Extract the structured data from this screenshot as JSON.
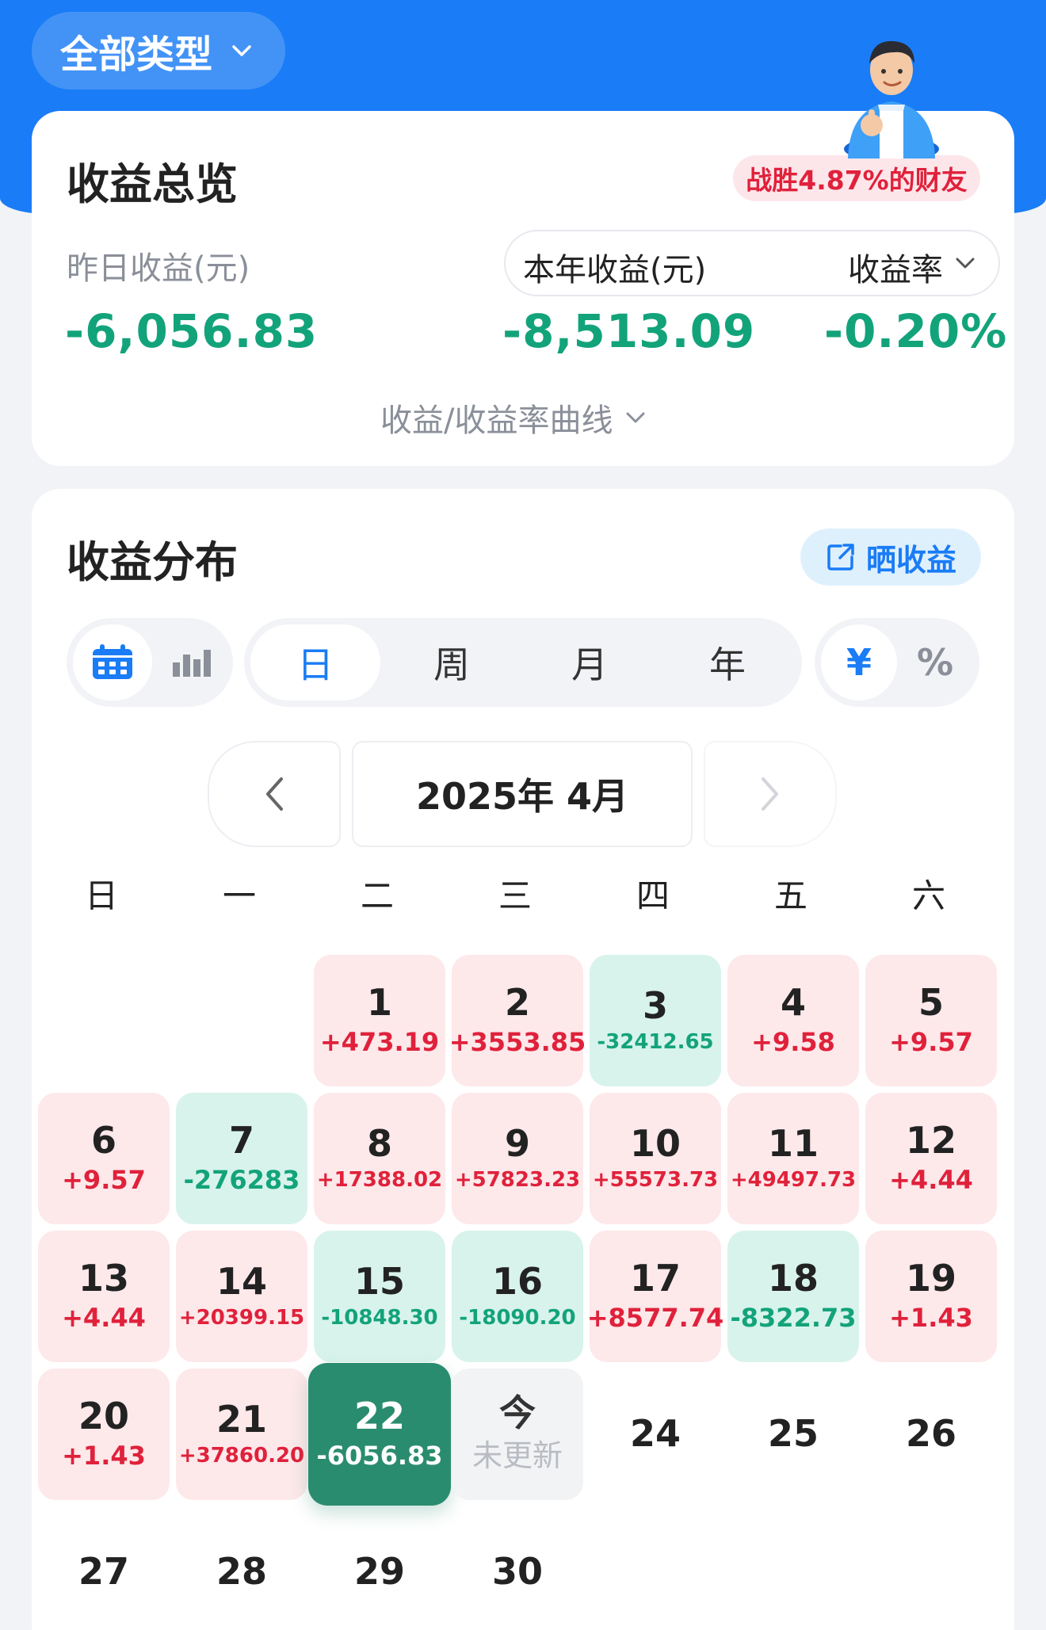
{
  "header": {
    "type_select": "全部类型"
  },
  "overview": {
    "title": "收益总览",
    "badge": "战胜4.87%的财友",
    "yesterday_label": "昨日收益(元)",
    "yesterday_value": "-6,056.83",
    "year_label": "本年收益(元)",
    "rate_label": "收益率",
    "year_value": "-8,513.09",
    "rate_value": "-0.20%",
    "curve_toggle": "收益/收益率曲线"
  },
  "distribution": {
    "title": "收益分布",
    "share_label": "晒收益",
    "periods": [
      "日",
      "周",
      "月",
      "年"
    ],
    "active_period": "日",
    "units": [
      "¥",
      "%"
    ],
    "month_label": "2025年 4月",
    "weekdays": [
      "日",
      "一",
      "二",
      "三",
      "四",
      "五",
      "六"
    ],
    "days": [
      {
        "day": "1",
        "value": "+473.19",
        "state": "pos"
      },
      {
        "day": "2",
        "value": "+3553.85",
        "state": "pos"
      },
      {
        "day": "3",
        "value": "-32412.65",
        "state": "neg"
      },
      {
        "day": "4",
        "value": "+9.58",
        "state": "pos"
      },
      {
        "day": "5",
        "value": "+9.57",
        "state": "pos"
      },
      {
        "day": "6",
        "value": "+9.57",
        "state": "pos"
      },
      {
        "day": "7",
        "value": "-276283",
        "state": "neg"
      },
      {
        "day": "8",
        "value": "+17388.02",
        "state": "pos"
      },
      {
        "day": "9",
        "value": "+57823.23",
        "state": "pos"
      },
      {
        "day": "10",
        "value": "+55573.73",
        "state": "pos"
      },
      {
        "day": "11",
        "value": "+49497.73",
        "state": "pos"
      },
      {
        "day": "12",
        "value": "+4.44",
        "state": "pos"
      },
      {
        "day": "13",
        "value": "+4.44",
        "state": "pos"
      },
      {
        "day": "14",
        "value": "+20399.15",
        "state": "pos"
      },
      {
        "day": "15",
        "value": "-10848.30",
        "state": "neg"
      },
      {
        "day": "16",
        "value": "-18090.20",
        "state": "neg"
      },
      {
        "day": "17",
        "value": "+8577.74",
        "state": "pos"
      },
      {
        "day": "18",
        "value": "-8322.73",
        "state": "neg"
      },
      {
        "day": "19",
        "value": "+1.43",
        "state": "pos"
      },
      {
        "day": "20",
        "value": "+1.43",
        "state": "pos"
      },
      {
        "day": "21",
        "value": "+37860.20",
        "state": "pos"
      },
      {
        "day": "22",
        "value": "-6056.83",
        "state": "sel"
      },
      {
        "day": "今",
        "value": "未更新",
        "state": "today"
      },
      {
        "day": "24",
        "value": "",
        "state": "none"
      },
      {
        "day": "25",
        "value": "",
        "state": "none"
      },
      {
        "day": "26",
        "value": "",
        "state": "none"
      },
      {
        "day": "27",
        "value": "",
        "state": "none"
      },
      {
        "day": "28",
        "value": "",
        "state": "none"
      },
      {
        "day": "29",
        "value": "",
        "state": "none"
      },
      {
        "day": "30",
        "value": "",
        "state": "none"
      }
    ]
  }
}
